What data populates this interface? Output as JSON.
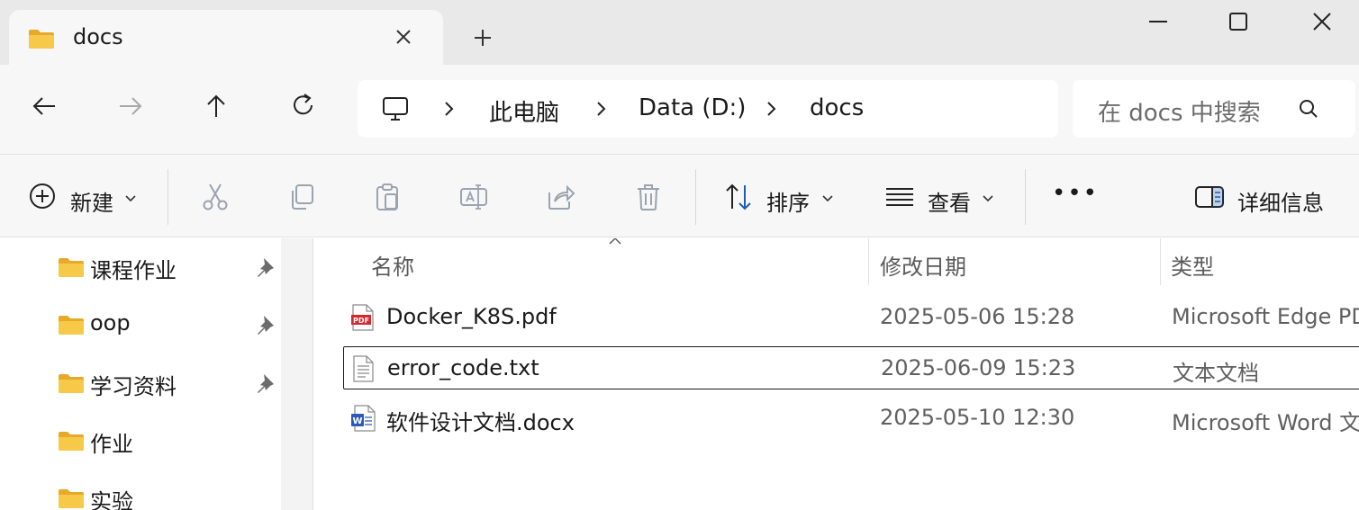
{
  "tab": {
    "title": "docs"
  },
  "breadcrumb": {
    "items": [
      "此电脑",
      "Data (D:)",
      "docs"
    ]
  },
  "search": {
    "placeholder": "在 docs 中搜索"
  },
  "commands": {
    "new_label": "新建",
    "sort_label": "排序",
    "view_label": "查看",
    "more_label": "•••",
    "details_label": "详细信息"
  },
  "nav_pane": {
    "items": [
      {
        "label": "课程作业",
        "pinned": true
      },
      {
        "label": "oop",
        "pinned": true
      },
      {
        "label": "学习资料",
        "pinned": true
      },
      {
        "label": "作业",
        "pinned": false
      },
      {
        "label": "实验",
        "pinned": false
      }
    ]
  },
  "columns": {
    "name": "名称",
    "modified": "修改日期",
    "type": "类型"
  },
  "files": [
    {
      "name": "Docker_K8S.pdf",
      "modified": "2025-05-06 15:28",
      "type": "Microsoft Edge PD",
      "icon": "pdf-file-icon"
    },
    {
      "name": "error_code.txt",
      "modified": "2025-06-09 15:23",
      "type": "文本文档",
      "icon": "text-file-icon"
    },
    {
      "name": "软件设计文档.docx",
      "modified": "2025-05-10 12:30",
      "type": "Microsoft Word 文",
      "icon": "word-file-icon"
    }
  ],
  "colors": {
    "folder": "#f5c342",
    "accent": "#0067c0",
    "pdf": "#d7262b",
    "word": "#2b5bb8"
  }
}
